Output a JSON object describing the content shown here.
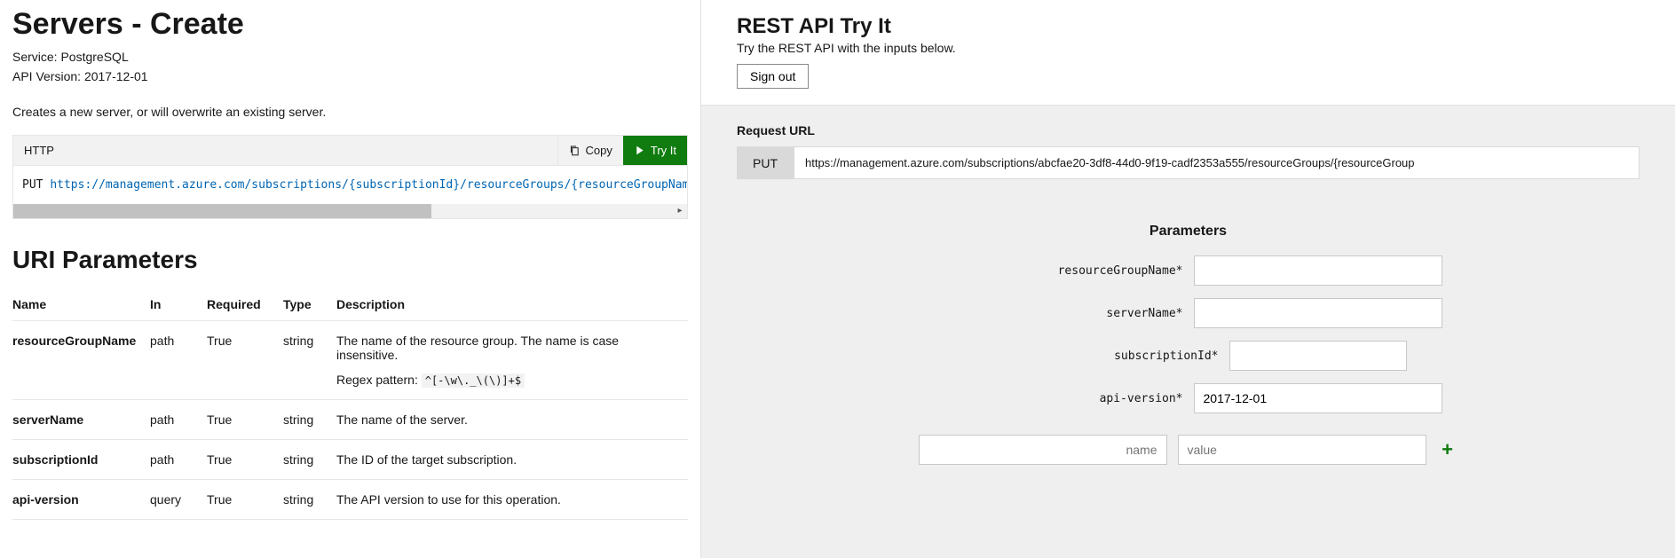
{
  "left": {
    "title": "Servers - Create",
    "service_label": "Service:",
    "service_value": "PostgreSQL",
    "apiver_label": "API Version:",
    "apiver_value": "2017-12-01",
    "description": "Creates a new server, or will overwrite an existing server.",
    "code_lang": "HTTP",
    "copy_label": "Copy",
    "tryit_label": "Try It",
    "http_verb": "PUT",
    "http_url": "https://management.azure.com/subscriptions/{subscriptionId}/resourceGroups/{resourceGroupName}/providers/Micro",
    "section_title": "URI Parameters",
    "table": {
      "headers": {
        "name": "Name",
        "in": "In",
        "required": "Required",
        "type": "Type",
        "desc": "Description"
      },
      "rows": [
        {
          "name": "resourceGroupName",
          "in": "path",
          "required": "True",
          "type": "string",
          "desc": "The name of the resource group. The name is case insensitive.",
          "regex_label": "Regex pattern:",
          "regex": "^[-\\w\\._\\(\\)]+$"
        },
        {
          "name": "serverName",
          "in": "path",
          "required": "True",
          "type": "string",
          "desc": "The name of the server."
        },
        {
          "name": "subscriptionId",
          "in": "path",
          "required": "True",
          "type": "string",
          "desc": "The ID of the target subscription."
        },
        {
          "name": "api-version",
          "in": "query",
          "required": "True",
          "type": "string",
          "desc": "The API version to use for this operation."
        }
      ]
    }
  },
  "right": {
    "title": "REST API Try It",
    "subtitle": "Try the REST API with the inputs below.",
    "signout": "Sign out",
    "request_url_label": "Request URL",
    "verb": "PUT",
    "url_value": "https://management.azure.com/subscriptions/abcfae20-3df8-44d0-9f19-cadf2353a555/resourceGroups/{resourceGroup",
    "params_heading": "Parameters",
    "params": [
      {
        "label": "resourceGroupName*",
        "value": "",
        "width": "wide"
      },
      {
        "label": "serverName*",
        "value": "",
        "width": "wide"
      },
      {
        "label": "subscriptionId*",
        "value": "",
        "width": "short"
      },
      {
        "label": "api-version*",
        "value": "2017-12-01",
        "width": "wide"
      }
    ],
    "add_name_placeholder": "name",
    "add_value_placeholder": "value"
  }
}
